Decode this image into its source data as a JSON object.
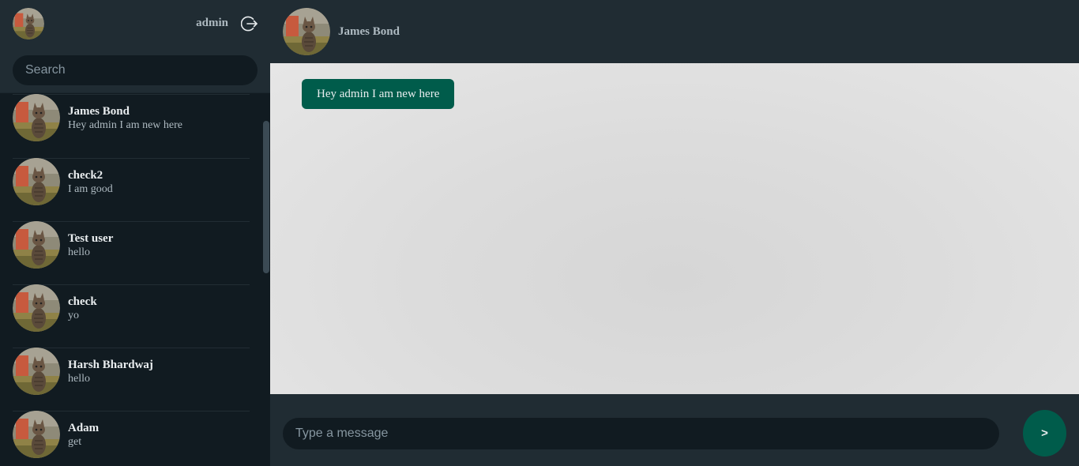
{
  "current_user": {
    "name": "admin",
    "avatar_icon": "cat-avatar"
  },
  "search": {
    "placeholder": "Search"
  },
  "contacts": [
    {
      "name": "James Bond",
      "last_message": "Hey admin I am new here"
    },
    {
      "name": "check2",
      "last_message": "I am good"
    },
    {
      "name": "Test user",
      "last_message": "hello"
    },
    {
      "name": "check",
      "last_message": "yo"
    },
    {
      "name": "Harsh Bhardwaj",
      "last_message": "hello"
    },
    {
      "name": "Adam",
      "last_message": "get"
    }
  ],
  "chat": {
    "title": "James Bond",
    "messages": [
      {
        "text": "Hey admin I am new here"
      }
    ]
  },
  "composer": {
    "placeholder": "Type a message",
    "send_label": ">"
  },
  "colors": {
    "panel": "#202c33",
    "background": "#111b21",
    "accent": "#005c4b",
    "chat_background": "#dcdcdc"
  },
  "icons": {
    "logout": "logout-icon"
  }
}
